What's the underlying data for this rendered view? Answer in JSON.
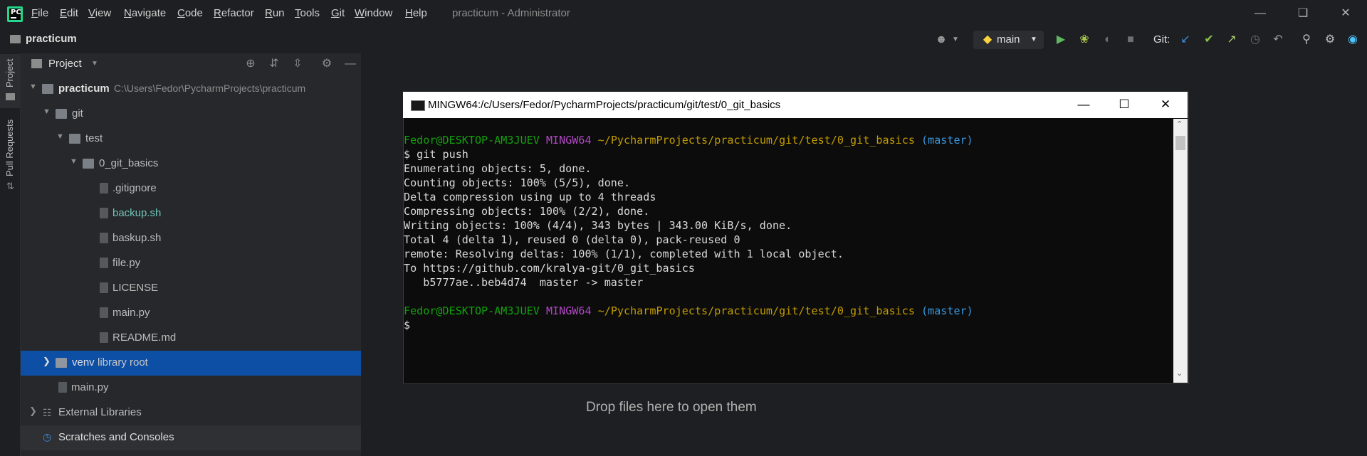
{
  "menu": [
    "File",
    "Edit",
    "View",
    "Navigate",
    "Code",
    "Refactor",
    "Run",
    "Tools",
    "Git",
    "Window",
    "Help"
  ],
  "window_title": "practicum - Administrator",
  "nav": {
    "project": "practicum",
    "branch": "main",
    "git_label": "Git:"
  },
  "tool_stripe": {
    "project_tab": "Project",
    "pull_requests_tab": "Pull Requests"
  },
  "panel": {
    "title": "Project"
  },
  "tree": {
    "root": {
      "name": "practicum",
      "path": "C:\\Users\\Fedor\\PycharmProjects\\practicum"
    },
    "git": "git",
    "test": "test",
    "basics": "0_git_basics",
    "files": [
      ".gitignore",
      "backup.sh",
      "baskup.sh",
      "file.py",
      "LICENSE",
      "main.py",
      "README.md"
    ],
    "venv": "venv",
    "venv_note": "library root",
    "root_main": "main.py",
    "external": "External Libraries",
    "scratches": "Scratches and Consoles"
  },
  "drop_hint": "Drop files here to open them",
  "terminal": {
    "title": "MINGW64:/c/Users/Fedor/PycharmProjects/practicum/git/test/0_git_basics",
    "user": "Fedor@DESKTOP-AM3JUEV",
    "env": "MINGW64",
    "cwd": "~/PycharmProjects/practicum/git/test/0_git_basics",
    "branch": "(master)",
    "command": "$ git push",
    "output": [
      "Enumerating objects: 5, done.",
      "Counting objects: 100% (5/5), done.",
      "Delta compression using up to 4 threads",
      "Compressing objects: 100% (2/2), done.",
      "Writing objects: 100% (4/4), 343 bytes | 343.00 KiB/s, done.",
      "Total 4 (delta 1), reused 0 (delta 0), pack-reused 0",
      "remote: Resolving deltas: 100% (1/1), completed with 1 local object.",
      "To https://github.com/kralya-git/0_git_basics",
      "   b5777ae..beb4d74  master -> master"
    ],
    "prompt": "$"
  }
}
